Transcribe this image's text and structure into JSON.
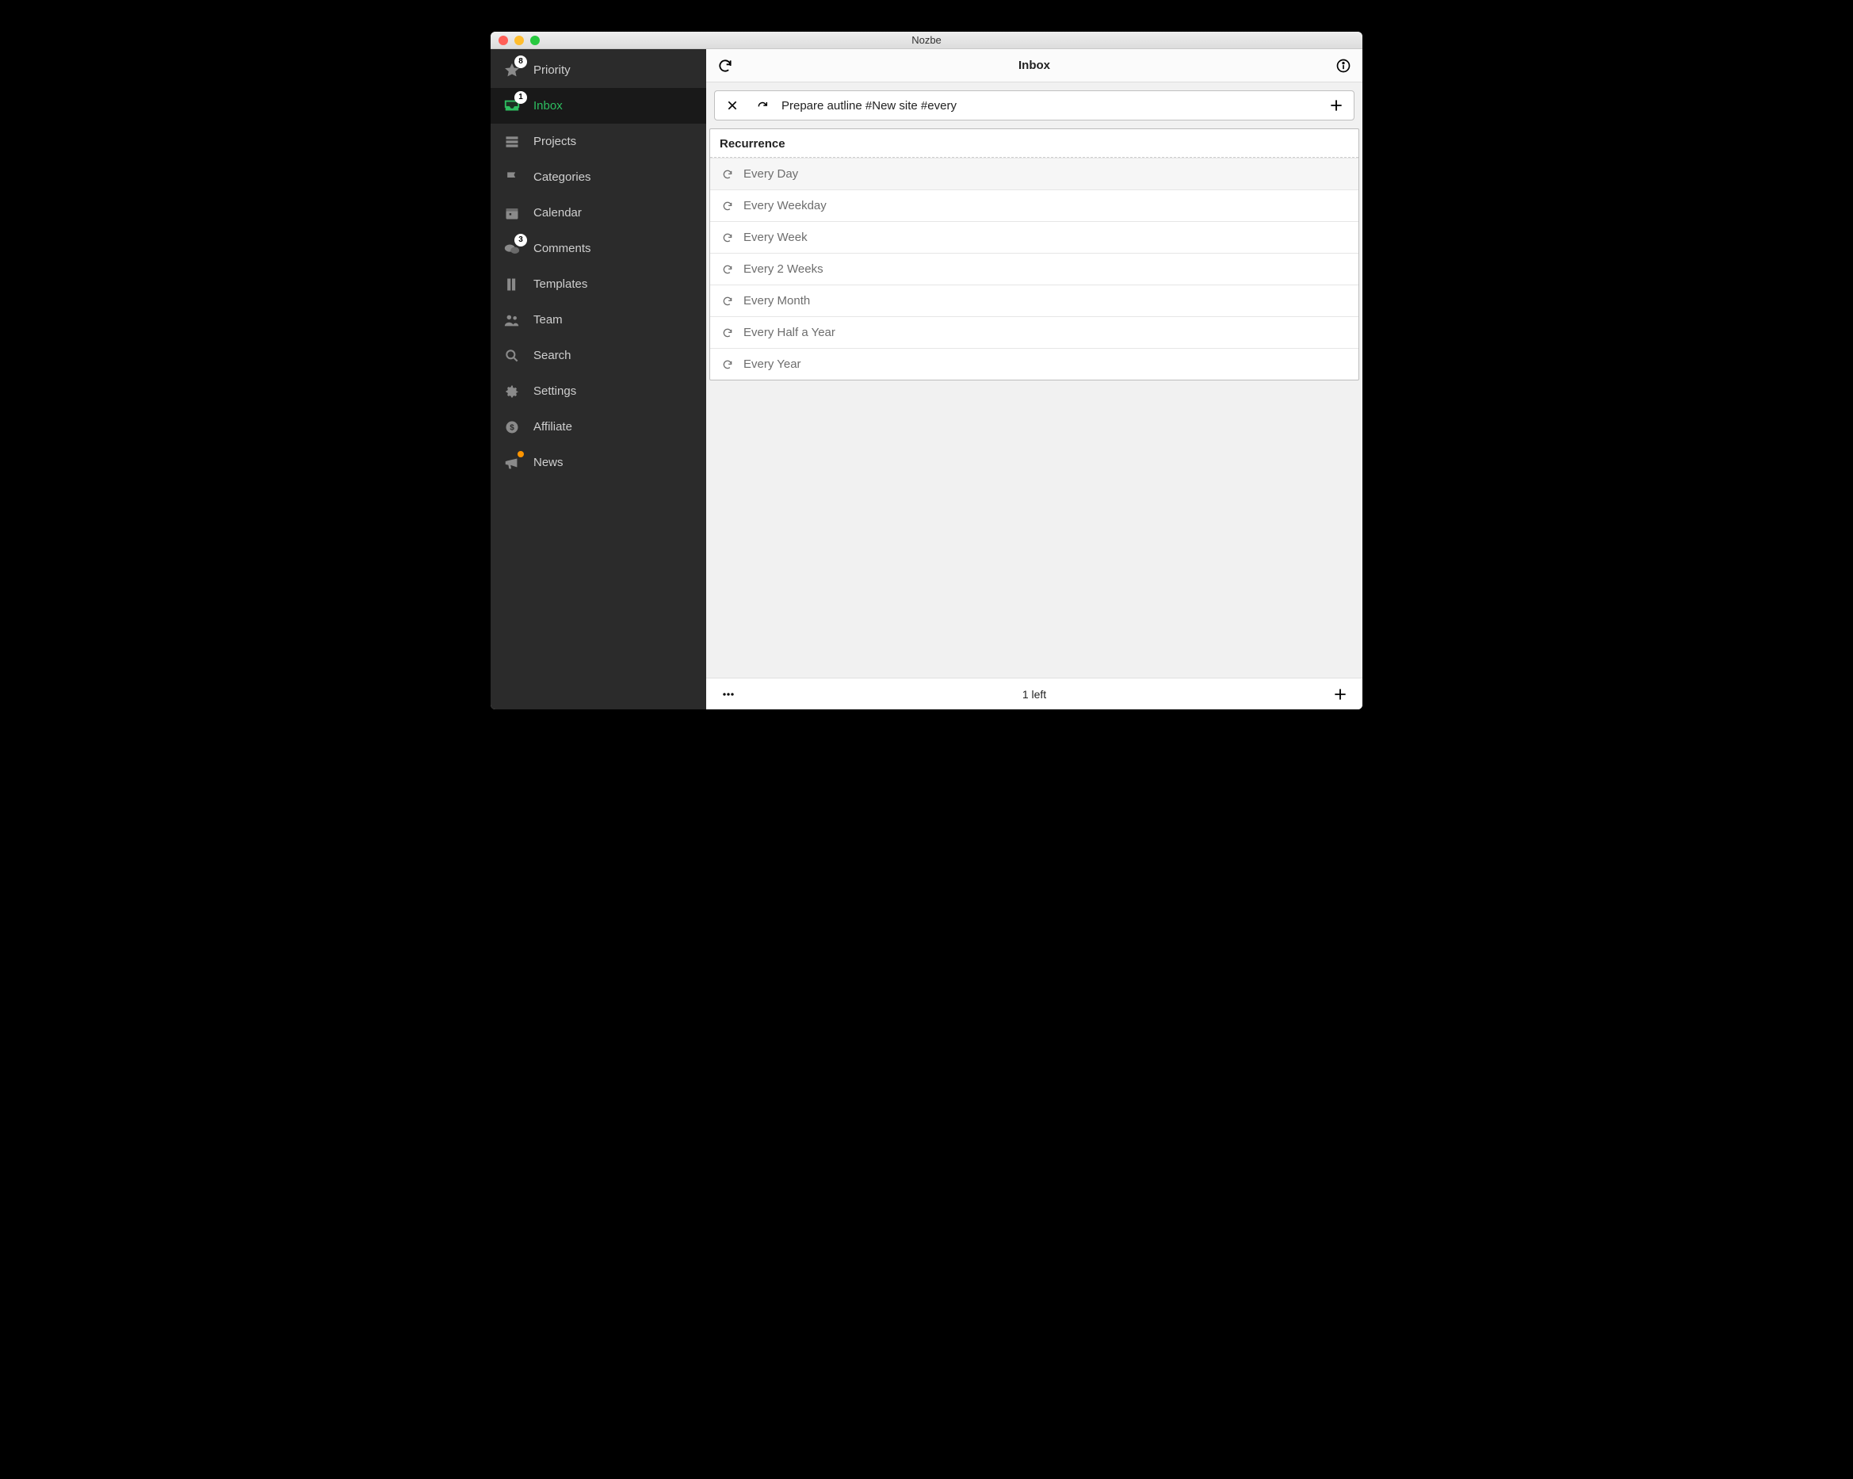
{
  "window": {
    "title": "Nozbe"
  },
  "sidebar": {
    "items": [
      {
        "label": "Priority",
        "icon": "star",
        "badge": "8"
      },
      {
        "label": "Inbox",
        "icon": "inbox",
        "badge": "1",
        "active": true
      },
      {
        "label": "Projects",
        "icon": "projects"
      },
      {
        "label": "Categories",
        "icon": "flag"
      },
      {
        "label": "Calendar",
        "icon": "calendar"
      },
      {
        "label": "Comments",
        "icon": "comments",
        "badge": "3"
      },
      {
        "label": "Templates",
        "icon": "templates"
      },
      {
        "label": "Team",
        "icon": "team"
      },
      {
        "label": "Search",
        "icon": "search"
      },
      {
        "label": "Settings",
        "icon": "gear"
      },
      {
        "label": "Affiliate",
        "icon": "dollar"
      },
      {
        "label": "News",
        "icon": "megaphone",
        "dot": true
      }
    ]
  },
  "header": {
    "title": "Inbox"
  },
  "entry": {
    "value": "Prepare autline #New site #every"
  },
  "suggest": {
    "header": "Recurrence",
    "items": [
      "Every Day",
      "Every Weekday",
      "Every Week",
      "Every 2 Weeks",
      "Every Month",
      "Every Half a Year",
      "Every Year"
    ]
  },
  "footer": {
    "status": "1 left"
  }
}
